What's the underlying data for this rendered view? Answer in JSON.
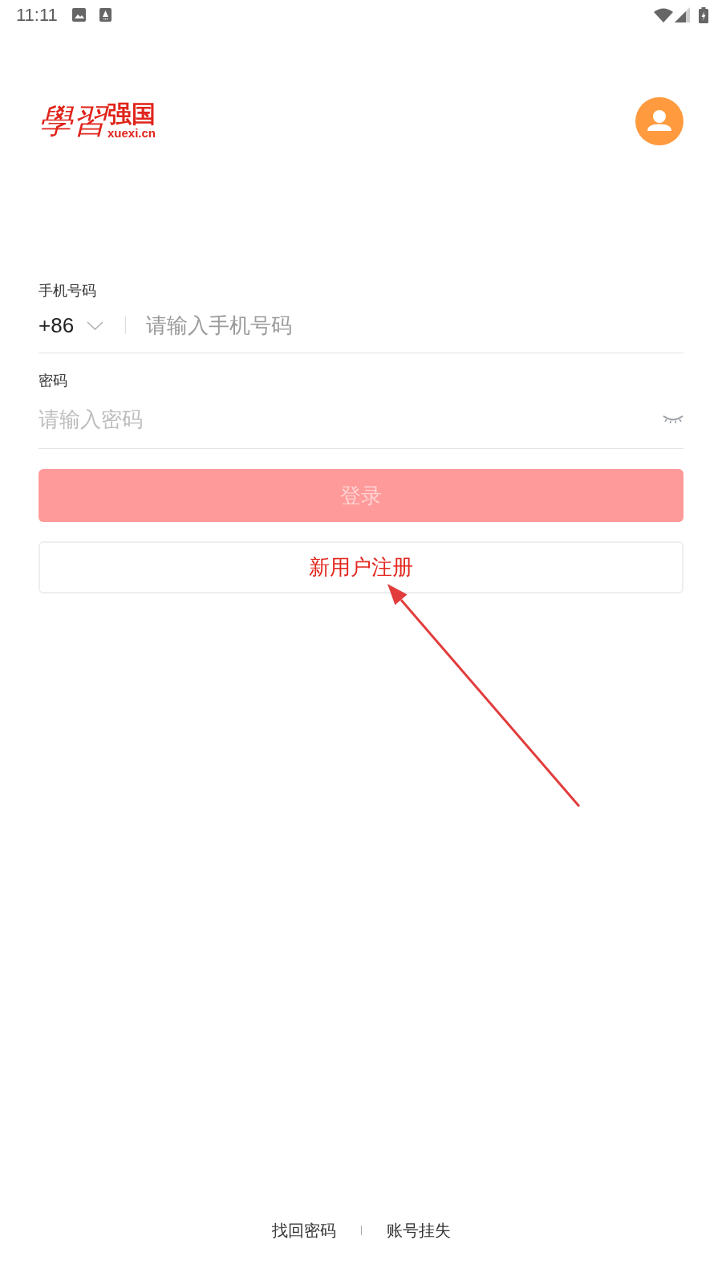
{
  "status_bar": {
    "time": "11:11"
  },
  "header": {
    "logo": {
      "calligraphy": "學習",
      "title": "强国",
      "domain": "xuexi.cn"
    }
  },
  "form": {
    "phone": {
      "label": "手机号码",
      "country_code": "+86",
      "placeholder": "请输入手机号码"
    },
    "password": {
      "label": "密码",
      "placeholder": "请输入密码",
      "visible": false
    }
  },
  "buttons": [
    {
      "kind": "primary",
      "label": "登录",
      "disabled": true
    },
    {
      "kind": "outline",
      "label": "新用户注册",
      "disabled": false
    }
  ],
  "footer_links": [
    "找回密码",
    "账号挂失"
  ]
}
